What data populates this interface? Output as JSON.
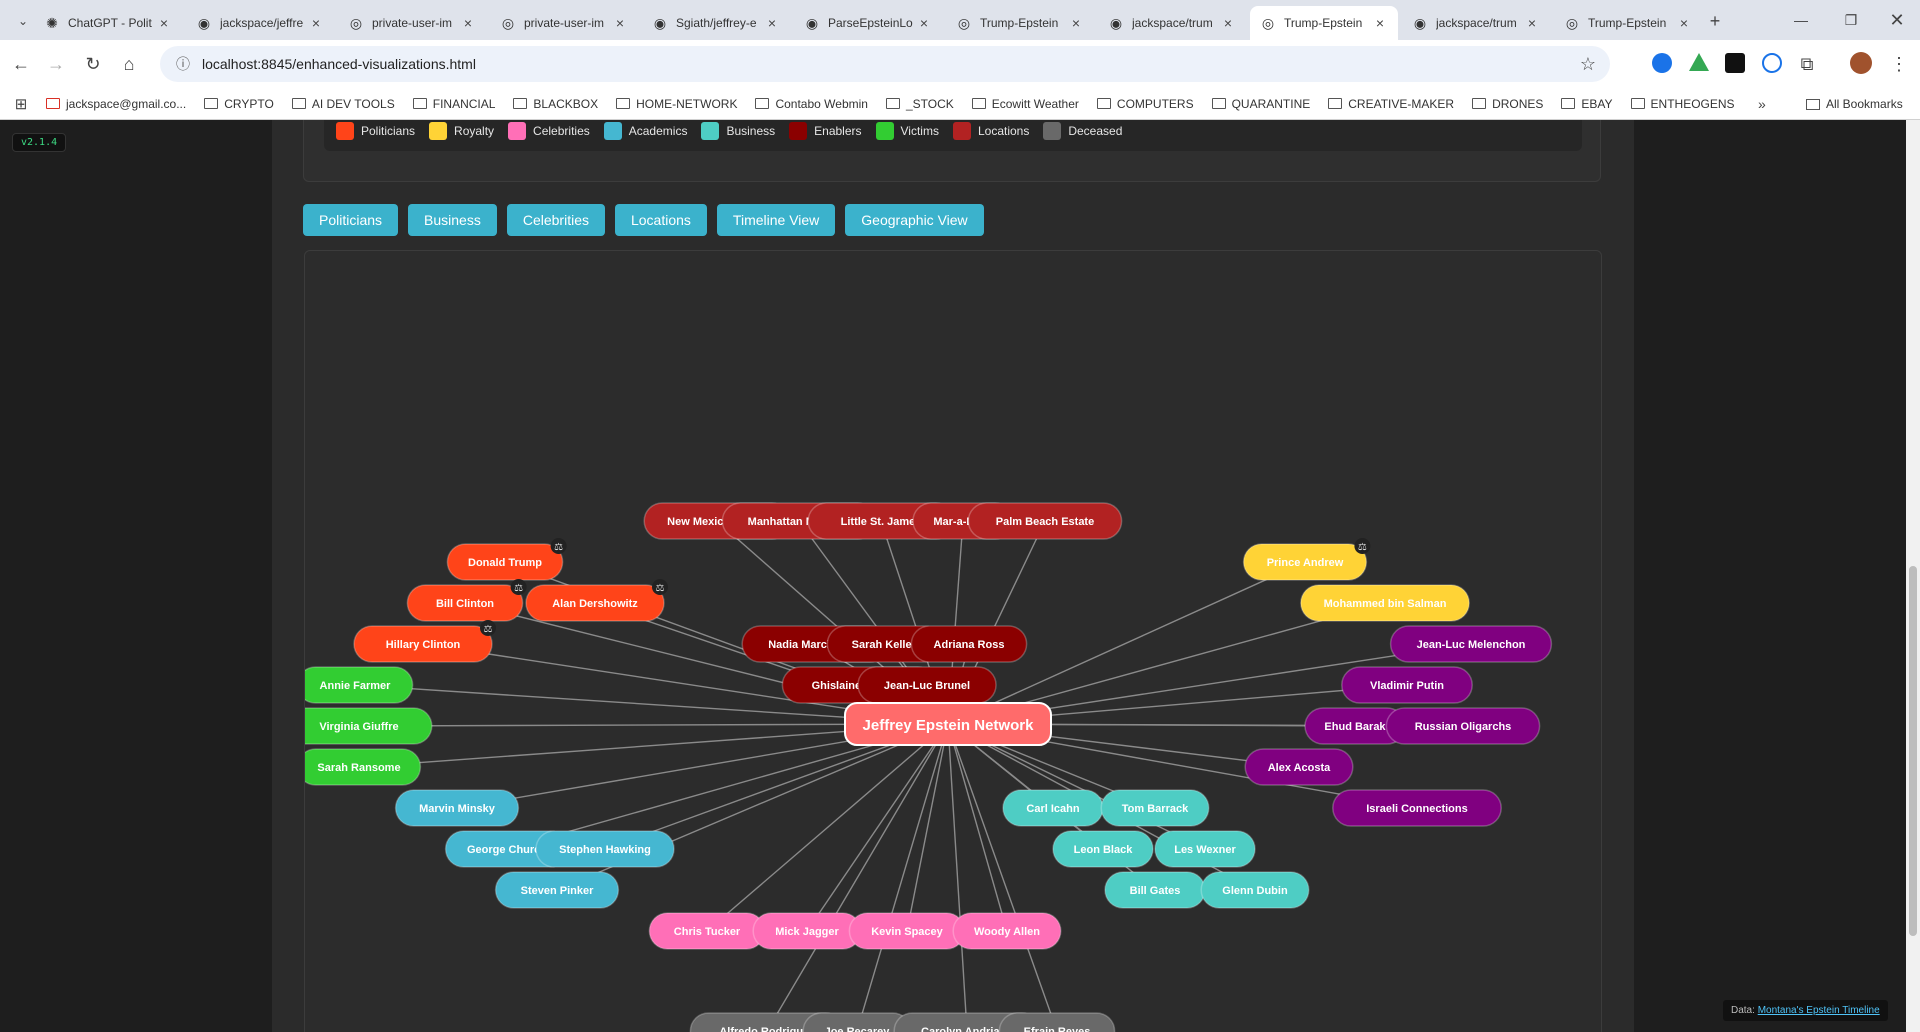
{
  "browser": {
    "tabs": [
      {
        "title": "ChatGPT - Polit",
        "icon": "chatgpt-icon"
      },
      {
        "title": "jackspace/jeffre",
        "icon": "github-icon"
      },
      {
        "title": "private-user-im",
        "icon": "globe-icon"
      },
      {
        "title": "private-user-im",
        "icon": "globe-icon"
      },
      {
        "title": "Sgiath/jeffrey-e",
        "icon": "github-icon"
      },
      {
        "title": "ParseEpsteinLo",
        "icon": "github-icon"
      },
      {
        "title": "Trump-Epstein",
        "icon": "globe-icon"
      },
      {
        "title": "jackspace/trum",
        "icon": "github-icon"
      },
      {
        "title": "Trump-Epstein",
        "icon": "globe-icon",
        "active": true
      },
      {
        "title": "jackspace/trum",
        "icon": "github-icon"
      },
      {
        "title": "Trump-Epstein",
        "icon": "globe-icon"
      }
    ],
    "url": "localhost:8845/enhanced-visualizations.html",
    "bookmarks": [
      "jackspace@gmail.co...",
      "CRYPTO",
      "AI DEV TOOLS",
      "FINANCIAL",
      "BLACKBOX",
      "HOME-NETWORK",
      "Contabo Webmin",
      "_STOCK",
      "Ecowitt Weather",
      "COMPUTERS",
      "QUARANTINE",
      "CREATIVE-MAKER",
      "DRONES",
      "EBAY",
      "ENTHEOGENS"
    ],
    "all_bookmarks": "All Bookmarks",
    "overflow": "»"
  },
  "version": "v2.1.4",
  "legend": [
    {
      "label": "Politicians",
      "color": "#ff4419"
    },
    {
      "label": "Royalty",
      "color": "#ffd336"
    },
    {
      "label": "Celebrities",
      "color": "#ff6fb7"
    },
    {
      "label": "Academics",
      "color": "#45b7d1"
    },
    {
      "label": "Business",
      "color": "#4ecdc4"
    },
    {
      "label": "Enablers",
      "color": "#8b0000"
    },
    {
      "label": "Victims",
      "color": "#32cd32"
    },
    {
      "label": "Locations",
      "color": "#b22222"
    },
    {
      "label": "Deceased",
      "color": "#696969"
    }
  ],
  "filter_buttons": [
    "Politicians",
    "Business",
    "Celebrities",
    "Locations",
    "Timeline View",
    "Geographic View"
  ],
  "network": {
    "center": "Jeffrey Epstein Network",
    "nodes": [
      {
        "label": "New Mexico Ranch",
        "cat": "Locations"
      },
      {
        "label": "Manhattan Mansion",
        "cat": "Locations"
      },
      {
        "label": "Little St. James",
        "cat": "Locations"
      },
      {
        "label": "Mar-a-Lago",
        "cat": "Locations"
      },
      {
        "label": "Palm Beach Estate",
        "cat": "Locations"
      },
      {
        "label": "Donald Trump",
        "cat": "Politicians",
        "marker": true
      },
      {
        "label": "Bill Clinton",
        "cat": "Politicians",
        "marker": true
      },
      {
        "label": "Alan Dershowitz",
        "cat": "Politicians",
        "marker": true
      },
      {
        "label": "Hillary Clinton",
        "cat": "Politicians",
        "marker": true
      },
      {
        "label": "Prince Andrew",
        "cat": "Royalty",
        "marker": true
      },
      {
        "label": "Mohammed bin Salman",
        "cat": "Royalty"
      },
      {
        "label": "Jean-Luc Melenchon",
        "cat": "Foreign"
      },
      {
        "label": "Vladimir Putin",
        "cat": "Foreign"
      },
      {
        "label": "Ehud Barak",
        "cat": "Foreign"
      },
      {
        "label": "Russian Oligarchs",
        "cat": "Foreign"
      },
      {
        "label": "Alex Acosta",
        "cat": "Foreign"
      },
      {
        "label": "Israeli Connections",
        "cat": "Foreign"
      },
      {
        "label": "Nadia Marcinkova",
        "cat": "Enablers"
      },
      {
        "label": "Sarah Kellen",
        "cat": "Enablers"
      },
      {
        "label": "Adriana Ross",
        "cat": "Enablers"
      },
      {
        "label": "Ghislaine Maxwell",
        "cat": "Enablers"
      },
      {
        "label": "Jean-Luc Brunel",
        "cat": "Enablers"
      },
      {
        "label": "Annie Farmer",
        "cat": "Victims"
      },
      {
        "label": "Virginia Giuffre",
        "cat": "Victims"
      },
      {
        "label": "Sarah Ransome",
        "cat": "Victims"
      },
      {
        "label": "Marvin Minsky",
        "cat": "Academics"
      },
      {
        "label": "George Church",
        "cat": "Academics"
      },
      {
        "label": "Stephen Hawking",
        "cat": "Academics"
      },
      {
        "label": "Steven Pinker",
        "cat": "Academics"
      },
      {
        "label": "Carl Icahn",
        "cat": "Business"
      },
      {
        "label": "Tom Barrack",
        "cat": "Business"
      },
      {
        "label": "Leon Black",
        "cat": "Business"
      },
      {
        "label": "Les Wexner",
        "cat": "Business"
      },
      {
        "label": "Bill Gates",
        "cat": "Business"
      },
      {
        "label": "Glenn Dubin",
        "cat": "Business"
      },
      {
        "label": "Chris Tucker",
        "cat": "Celebrities"
      },
      {
        "label": "Mick Jagger",
        "cat": "Celebrities"
      },
      {
        "label": "Kevin Spacey",
        "cat": "Celebrities"
      },
      {
        "label": "Woody Allen",
        "cat": "Celebrities"
      },
      {
        "label": "Alfredo Rodriguez",
        "cat": "Deceased"
      },
      {
        "label": "Joe Recarey",
        "cat": "Deceased"
      },
      {
        "label": "Carolyn Andriano",
        "cat": "Deceased"
      },
      {
        "label": "Efrain Reyes",
        "cat": "Deceased"
      }
    ]
  },
  "footer": {
    "prefix": "Data: ",
    "link": "Montana's Epstein Timeline"
  }
}
